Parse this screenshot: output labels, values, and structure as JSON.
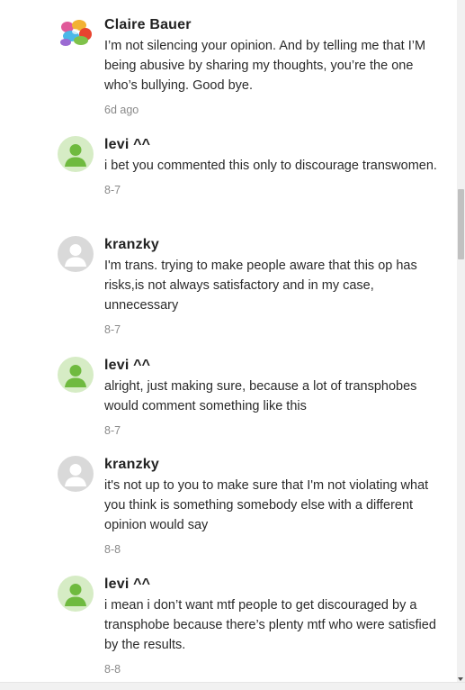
{
  "comments": [
    {
      "author": "Claire Bauer",
      "avatar": "colorful-photo-avatar",
      "text": "I’m not silencing your opinion. And by telling me that I’M being abusive by sharing my thoughts, you’re the one who’s bullying. Good bye.",
      "time": "6d ago"
    },
    {
      "author": "levi ^^",
      "avatar": "default-user-avatar-green",
      "text": "i bet you commented this only to discourage transwomen.",
      "time": "8-7"
    },
    {
      "author": "kranzky",
      "avatar": "default-user-avatar-gray",
      "text": "I'm trans. trying to make people aware that this op has risks,is not always satisfactory and in my case, unnecessary",
      "time": "8-7"
    },
    {
      "author": "levi ^^",
      "avatar": "default-user-avatar-green",
      "text": "alright, just making sure, because a lot of transphobes would comment something like this",
      "time": "8-7"
    },
    {
      "author": "kranzky",
      "avatar": "default-user-avatar-gray",
      "text": "it's not up to you to make sure that I'm not violating what you think is something somebody else with a different opinion would say",
      "time": "8-8"
    },
    {
      "author": "levi ^^",
      "avatar": "default-user-avatar-green",
      "text": "i mean i don’t want mtf people to get discouraged by a transphobe because there’s plenty mtf who were satisfied by the results.",
      "time": "8-8"
    }
  ],
  "colors": {
    "green_avatar_bg": "#d6ecc5",
    "green_avatar_fg": "#6fba3f",
    "gray_avatar_bg": "#d9d9d9",
    "gray_avatar_fg": "#ffffff",
    "timestamp": "#8a8a8a"
  }
}
